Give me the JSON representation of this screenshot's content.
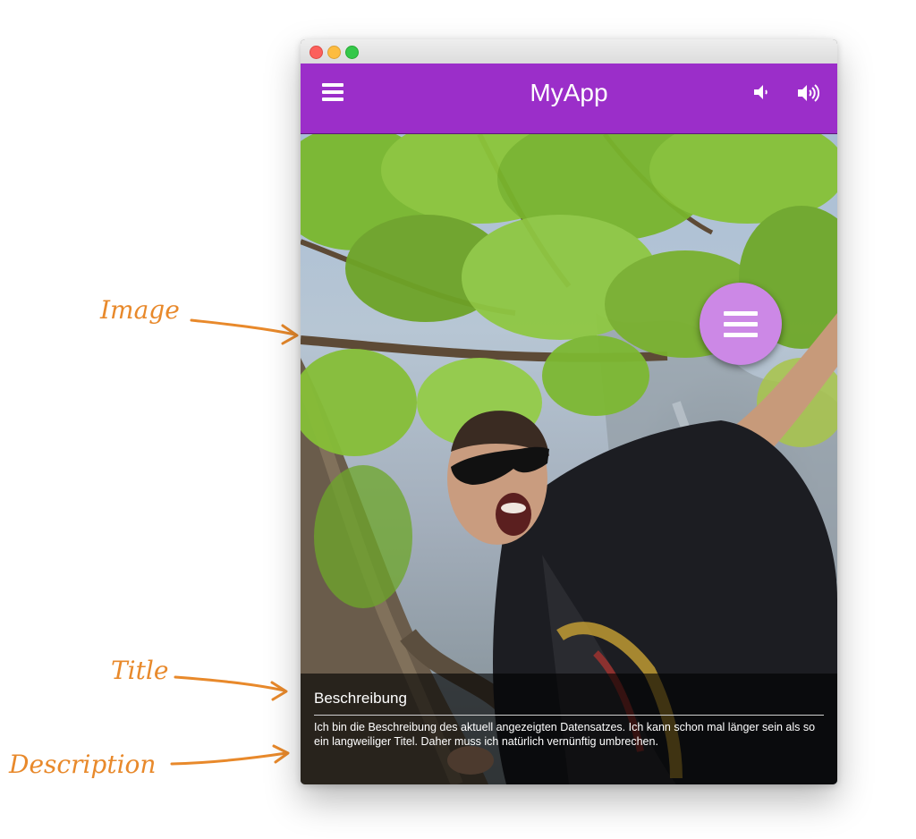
{
  "window": {
    "app_title": "MyApp",
    "icons": {
      "menu": "hamburger-icon",
      "volume_down": "volume-down-icon",
      "volume_up": "volume-up-icon",
      "fab": "hamburger-icon"
    }
  },
  "caption": {
    "title": "Beschreibung",
    "description": "Ich bin die Beschreibung des aktuell angezeigten Datensatzes. Ich kann schon mal länger sein als so ein langweiliger Titel. Daher muss ich natürlich vernünftig umbrechen."
  },
  "annotations": {
    "image": "Image",
    "title": "Title",
    "description": "Description"
  },
  "colors": {
    "appbar": "#9b2ec9",
    "fab": "#cc88e6",
    "annotation": "#e8892b"
  }
}
